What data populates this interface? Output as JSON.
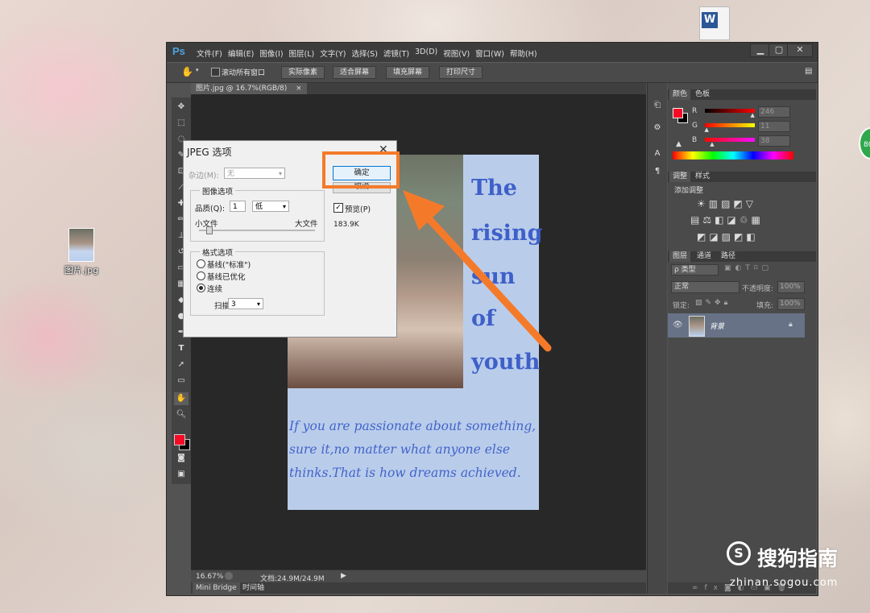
{
  "desktop": {
    "icon_label": "图片.jpg",
    "watermark_brand": "搜狗指南",
    "watermark_url": "zhinan.sogou.com",
    "edge_badge": "80",
    "word_icon_letter": "W"
  },
  "app": {
    "logo": "Ps",
    "menu": [
      "文件(F)",
      "编辑(E)",
      "图像(I)",
      "图层(L)",
      "文字(Y)",
      "选择(S)",
      "滤镜(T)",
      "3D(D)",
      "视图(V)",
      "窗口(W)",
      "帮助(H)"
    ],
    "window_buttons": [
      "▁",
      "▢",
      "✕"
    ]
  },
  "options_bar": {
    "scroll_all_label": "滚动所有窗口",
    "buttons": [
      "实际像素",
      "适合屏幕",
      "填充屏幕",
      "打印尺寸"
    ]
  },
  "document": {
    "tab_label": "图片.jpg @ 16.7%(RGB/8)",
    "tab_close": "×",
    "zoom": "16.67%",
    "doc_info": "文档:24.9M/24.9M"
  },
  "bottom_tabs": [
    "Mini Bridge",
    "时间轴"
  ],
  "artwork": {
    "title_lines": [
      "The",
      "rising",
      "sun",
      "of",
      "youth"
    ],
    "quote_lines": [
      "If you are passionate about something,",
      "sure it,no matter what anyone else",
      "thinks.That is how dreams achieved."
    ]
  },
  "color_panel": {
    "tabs": [
      "颜色",
      "色板"
    ],
    "channels": [
      {
        "label": "R",
        "value": "246",
        "fill": 0.96,
        "gradient": "linear-gradient(90deg,#000,#f00)"
      },
      {
        "label": "G",
        "value": "11",
        "fill": 0.04,
        "gradient": "linear-gradient(90deg,#f60000,#f6ff00)"
      },
      {
        "label": "B",
        "value": "38",
        "fill": 0.15,
        "gradient": "linear-gradient(90deg,#f60b00,#f60bff)"
      }
    ]
  },
  "adjust_panel": {
    "tabs": [
      "调整",
      "样式"
    ],
    "heading": "添加调整"
  },
  "layers_panel": {
    "tabs": [
      "图层",
      "通道",
      "路径"
    ],
    "kind_label": "ρ 类型",
    "blend_mode": "正常",
    "opacity_label": "不透明度:",
    "opacity_value": "100%",
    "lock_label": "锁定:",
    "fill_label": "填充:",
    "fill_value": "100%",
    "layer_name": "背景"
  },
  "dialog": {
    "title": "JPEG 选项",
    "close": "✕",
    "matte_label": "杂边(M):",
    "matte_value": "无",
    "image_group_label": "图像选项",
    "quality_label": "品质(Q):",
    "quality_value": "1",
    "quality_preset": "低",
    "small_file": "小文件",
    "large_file": "大文件",
    "quality_slider_fraction": 0.083,
    "format_group_label": "格式选项",
    "format_options": [
      "基线(\"标准\")",
      "基线已优化",
      "连续"
    ],
    "selected_format": "连续",
    "scans_label": "扫描:",
    "scans_value": "3",
    "ok_label": "确定",
    "cancel_label": "取消",
    "preview_label": "预览(P)",
    "preview_checked": true,
    "file_size": "183.9K"
  },
  "colors": {
    "highlight": "#f47a2a",
    "foreground": "#f60b26",
    "ps_blue": "#4ea3df"
  }
}
